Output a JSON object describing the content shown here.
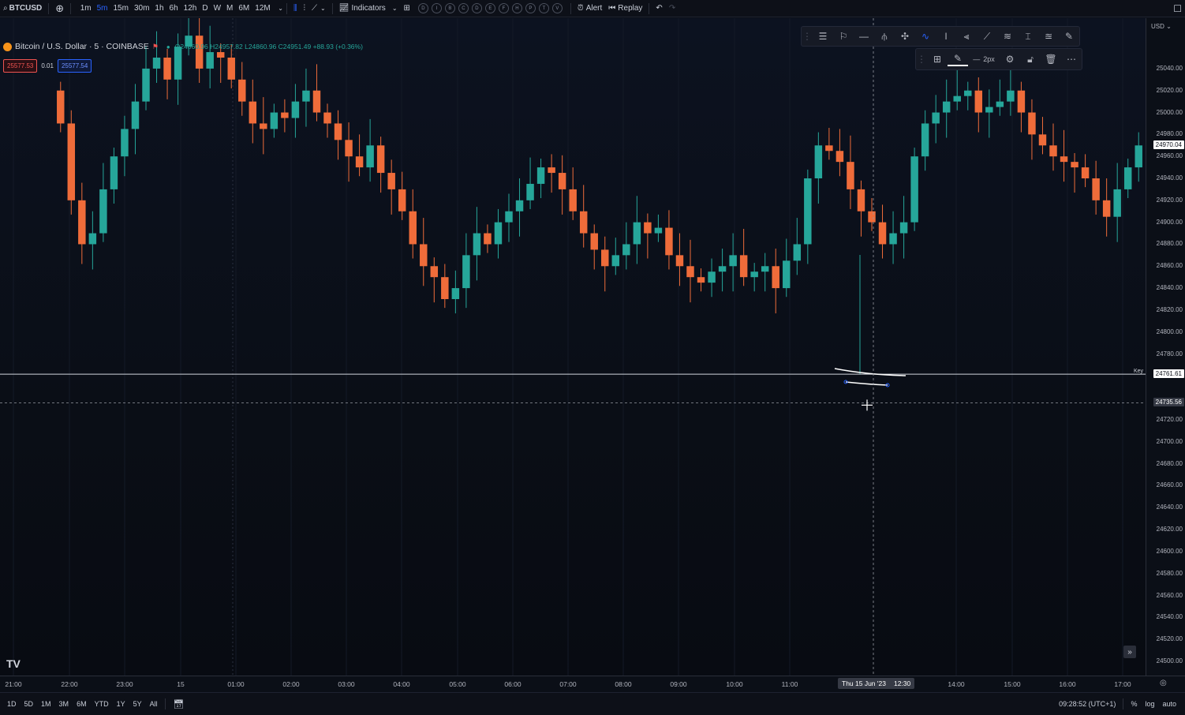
{
  "topbar": {
    "symbol": "BTCUSD",
    "timeframes": [
      "1m",
      "5m",
      "15m",
      "30m",
      "1h",
      "6h",
      "12h",
      "D",
      "W",
      "M",
      "6M",
      "12M"
    ],
    "active_timeframe": "5m",
    "indicators_label": "Indicators",
    "circle_buttons": [
      "D",
      "I",
      "B",
      "C",
      "D",
      "E",
      "F",
      "H",
      "P",
      "T",
      "V"
    ],
    "alert_label": "Alert",
    "replay_label": "Replay"
  },
  "legend": {
    "title": "Bitcoin / U.S. Dollar · 5 · COINBASE",
    "ohlc": "O24860.96 H24957.82 L24860.96 C24951.49 +88.93 (+0.36%)",
    "sell_price": "25577.53",
    "spread": "0.01",
    "buy_price": "25577.54"
  },
  "drawing_toolbar": {
    "width_label": "2px"
  },
  "price_axis": {
    "currency": "USD",
    "labels": [
      "25040.00",
      "25020.00",
      "25000.00",
      "24980.00",
      "24960.00",
      "24940.00",
      "24920.00",
      "24900.00",
      "24880.00",
      "24860.00",
      "24840.00",
      "24820.00",
      "24800.00",
      "24780.00",
      "24720.00",
      "24700.00",
      "24680.00",
      "24660.00",
      "24640.00",
      "24620.00",
      "24600.00",
      "24580.00",
      "24560.00",
      "24540.00",
      "24520.00",
      "24500.00"
    ],
    "current_price": "24970.04",
    "key_level_label": "Key",
    "key_level_price": "24761.61",
    "crosshair_price": "24735.56"
  },
  "time_axis": {
    "labels": [
      "21:00",
      "22:00",
      "23:00",
      "15",
      "01:00",
      "02:00",
      "03:00",
      "04:00",
      "05:00",
      "06:00",
      "07:00",
      "08:00",
      "09:00",
      "10:00",
      "11:00",
      "14:00",
      "15:00",
      "16:00",
      "17:00"
    ],
    "crosshair_date": "Thu 15 Jun '23",
    "crosshair_time": "12:30"
  },
  "bottombar": {
    "ranges": [
      "1D",
      "5D",
      "1M",
      "3M",
      "6M",
      "YTD",
      "1Y",
      "5Y",
      "All"
    ],
    "clock": "09:28:52 (UTC+1)",
    "percent_label": "%",
    "log_label": "log",
    "auto_label": "auto"
  },
  "colors": {
    "up": "#26a69a",
    "down": "#ef6c3a",
    "background": "#0b0f17",
    "accent": "#2962ff"
  },
  "chart_data": {
    "type": "candlestick",
    "symbol": "BTCUSD",
    "interval": "5",
    "exchange": "COINBASE",
    "ylim": [
      24490,
      25060
    ],
    "horizontal_line": 24761.61,
    "closes": [
      24990,
      24920,
      24880,
      24890,
      24930,
      24960,
      24985,
      25010,
      25040,
      25050,
      25030,
      25060,
      25070,
      25040,
      25055,
      25050,
      25030,
      25010,
      24990,
      24985,
      25000,
      24995,
      25010,
      25020,
      25000,
      24990,
      24975,
      24960,
      24950,
      24970,
      24945,
      24930,
      24910,
      24880,
      24860,
      24850,
      24830,
      24840,
      24870,
      24890,
      24880,
      24900,
      24910,
      24920,
      24935,
      24950,
      24945,
      24930,
      24910,
      24890,
      24875,
      24860,
      24870,
      24880,
      24900,
      24890,
      24895,
      24870,
      24860,
      24850,
      24845,
      24855,
      24860,
      24870,
      24850,
      24855,
      24860,
      24840,
      24865,
      24880,
      24940,
      24970,
      24965,
      24955,
      24930,
      24910,
      24900,
      24880,
      24890,
      24900,
      24960,
      24990,
      25000,
      25010,
      25015,
      25020,
      25000,
      25005,
      25010,
      25020,
      25000,
      24980,
      24970,
      24960,
      24955,
      24950,
      24940,
      24920,
      24905,
      24930,
      24950,
      24970
    ]
  }
}
